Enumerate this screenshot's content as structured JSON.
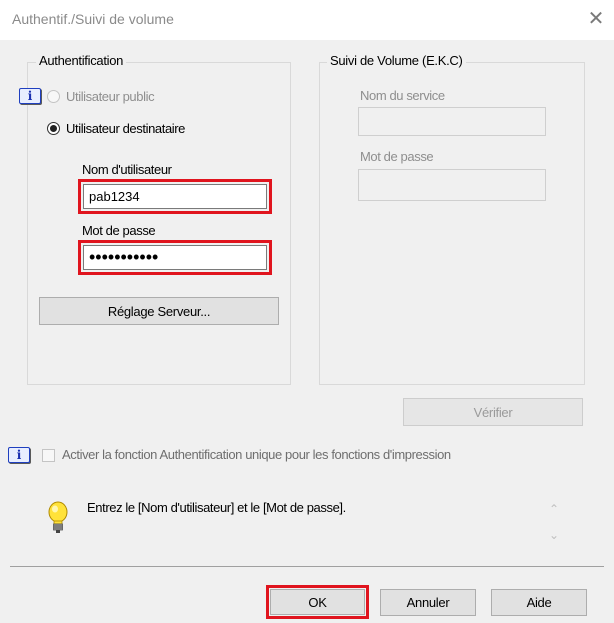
{
  "window": {
    "title": "Authentif./Suivi de volume"
  },
  "auth_group": {
    "title": "Authentification",
    "public_user_label": "Utilisateur public",
    "dest_user_label": "Utilisateur destinataire",
    "username_label": "Nom d'utilisateur",
    "username_value": "pab1234",
    "password_label": "Mot de passe",
    "password_value": "•••••••••••",
    "server_button": "Réglage Serveur..."
  },
  "volume_group": {
    "title": "Suivi de Volume (E.K.C)",
    "service_label": "Nom du service",
    "password_label": "Mot de passe"
  },
  "verify_button": "Vérifier",
  "single_auth_label": "Activer la fonction Authentification unique pour les fonctions d'impression",
  "message": "Entrez le [Nom d'utilisateur] et le [Mot de passe].",
  "buttons": {
    "ok": "OK",
    "cancel": "Annuler",
    "help": "Aide"
  },
  "icons": {
    "info": "info-icon",
    "bulb": "lightbulb-icon",
    "close": "close-icon"
  },
  "colors": {
    "highlight": "#e0141e",
    "info_blue": "#1a2fb0",
    "bulb_yellow": "#ffe23a"
  }
}
